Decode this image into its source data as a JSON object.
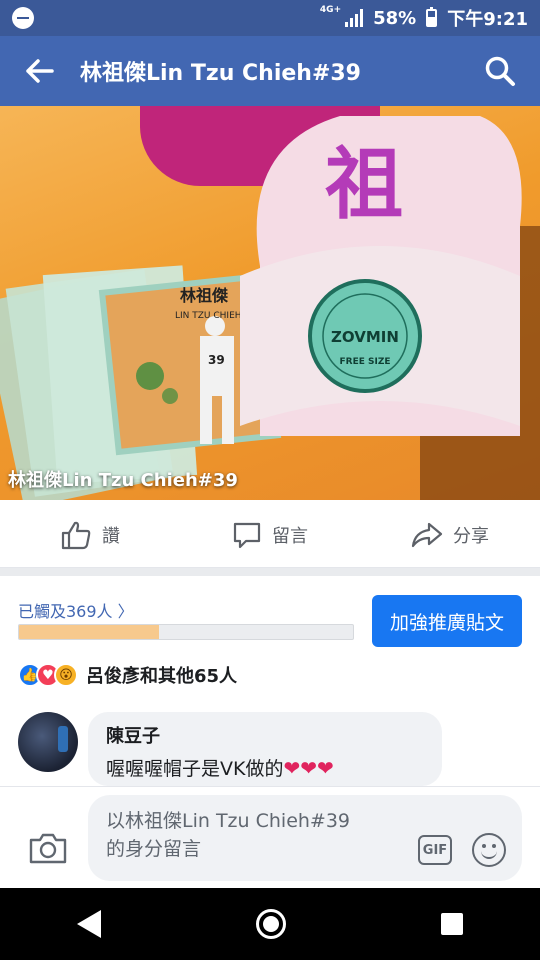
{
  "status_bar": {
    "network": "4G+",
    "battery": "58%",
    "time": "下午9:21"
  },
  "app_bar": {
    "title": "林祖傑Lin Tzu Chieh#39",
    "back_icon": "back-arrow-icon",
    "search_icon": "search-icon"
  },
  "photo": {
    "caption": "林祖傑Lin Tzu Chieh#39",
    "cap_text": "祖",
    "patch_text": "ZOVMIN",
    "patch_sub": "FREE SIZE",
    "card_name": "林祖傑",
    "card_sub": "LIN TZU CHIEH",
    "jersey": "39"
  },
  "actions": [
    {
      "label": "讚",
      "icon": "thumbs-up-icon"
    },
    {
      "label": "留言",
      "icon": "comment-icon"
    },
    {
      "label": "分享",
      "icon": "share-icon"
    }
  ],
  "reach": {
    "text": "已觸及369人 〉",
    "progress": 0.42
  },
  "boost_button": "加強推廣貼文",
  "reactions": {
    "text": "呂俊彥和其他65人",
    "icons": [
      "like",
      "love",
      "wow"
    ],
    "like_glyph": "👍",
    "love_glyph": "♥",
    "wow_glyph": "😮"
  },
  "comment": {
    "author": "陳豆子",
    "text": "喔喔喔帽子是VK做的",
    "hearts": "❤❤❤"
  },
  "composer": {
    "placeholder_line1": "以林祖傑Lin Tzu Chieh#39",
    "placeholder_line2": "的身分留言",
    "gif_label": "GIF"
  },
  "colors": {
    "header_blue": "#4267b2",
    "status_blue": "#3b5998",
    "boost_blue": "#1877f2",
    "progress_fill": "#f7c98d"
  }
}
